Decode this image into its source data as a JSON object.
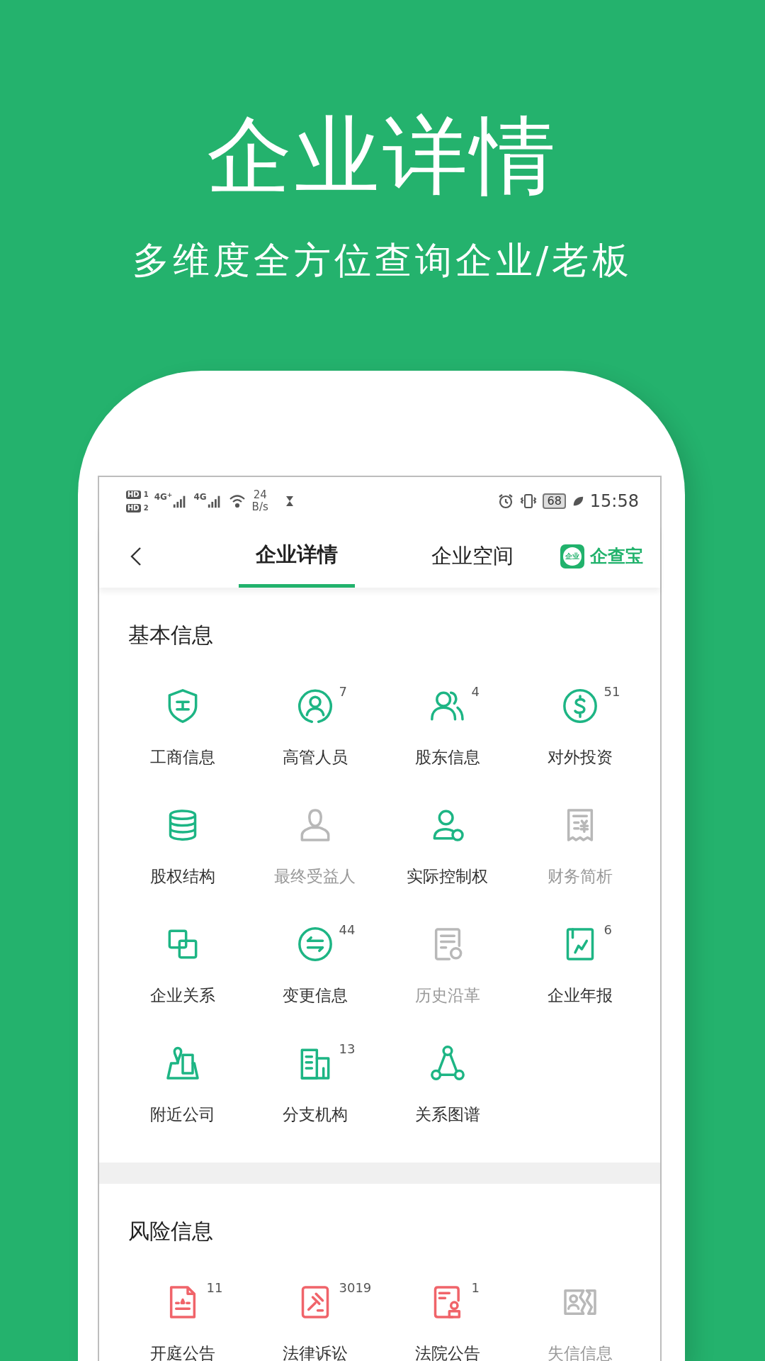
{
  "headline": "企业详情",
  "subtitle": "多维度全方位查询企业/老板",
  "status_bar": {
    "sims": [
      {
        "hd": "HD",
        "slot": "1",
        "network": "4G$^{+}$"
      },
      {
        "hd": "HD",
        "slot": "2",
        "network": "4G"
      }
    ],
    "speed": "24",
    "speed_unit": "B/s",
    "battery": "68",
    "time": "15:58"
  },
  "nav": {
    "tabs": [
      {
        "label": "企业详情",
        "selected": true
      },
      {
        "label": "企业空间",
        "selected": false
      }
    ],
    "brand_badge": "企业",
    "brand": "企查宝"
  },
  "sections": [
    {
      "title": "基本信息",
      "kind": "basic",
      "items": [
        {
          "label": "工商信息",
          "disabled": false
        },
        {
          "label": "高管人员",
          "count": "7",
          "disabled": false
        },
        {
          "label": "股东信息",
          "count": "4",
          "disabled": false
        },
        {
          "label": "对外投资",
          "count": "51",
          "disabled": false
        },
        {
          "label": "股权结构",
          "disabled": false
        },
        {
          "label": "最终受益人",
          "disabled": true
        },
        {
          "label": "实际控制权",
          "disabled": false
        },
        {
          "label": "财务简析",
          "disabled": true
        },
        {
          "label": "企业关系",
          "disabled": false
        },
        {
          "label": "变更信息",
          "count": "44",
          "disabled": false
        },
        {
          "label": "历史沿革",
          "disabled": true
        },
        {
          "label": "企业年报",
          "count": "6",
          "disabled": false
        },
        {
          "label": "附近公司",
          "disabled": false
        },
        {
          "label": "分支机构",
          "count": "13",
          "disabled": false
        },
        {
          "label": "关系图谱",
          "disabled": false
        }
      ]
    },
    {
      "title": "风险信息",
      "kind": "risk",
      "items": [
        {
          "label": "开庭公告",
          "count": "11",
          "disabled": false
        },
        {
          "label": "法律诉讼",
          "count": "3019",
          "disabled": false
        },
        {
          "label": "法院公告",
          "count": "1",
          "disabled": false
        },
        {
          "label": "失信信息",
          "disabled": true
        }
      ]
    }
  ]
}
